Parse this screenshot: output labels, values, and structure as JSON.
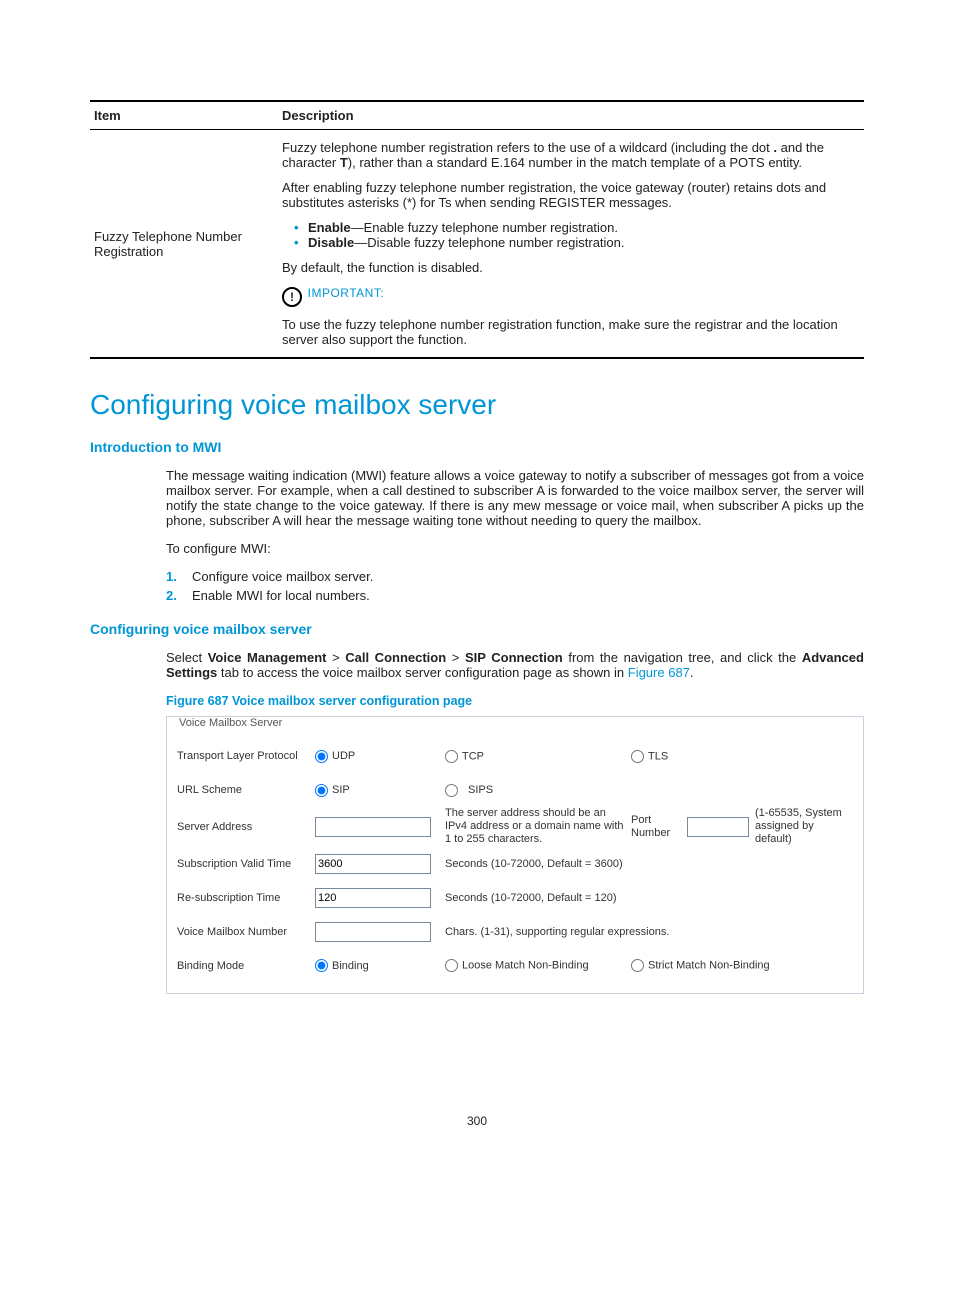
{
  "table": {
    "header_item": "Item",
    "header_desc": "Description",
    "row_label": "Fuzzy Telephone Number Registration",
    "p1_a": "Fuzzy telephone number registration refers to the use of a wildcard (including the dot ",
    "p1_dot": ".",
    "p1_b": " and the character ",
    "p1_T": "T",
    "p1_c": "), rather than a standard E.164 number in the match template of a POTS entity.",
    "p2": "After enabling fuzzy telephone number registration, the voice gateway (router) retains dots and substitutes asterisks (*) for Ts when sending REGISTER messages.",
    "li1_k": "Enable",
    "li1_t": "—Enable fuzzy telephone number registration.",
    "li2_k": "Disable",
    "li2_t": "—Disable fuzzy telephone number registration.",
    "p3": "By default, the function is disabled.",
    "important": "IMPORTANT:",
    "p4": "To use the fuzzy telephone number registration function, make sure the registrar and the location server also support the function."
  },
  "h1": "Configuring voice mailbox server",
  "intro_h": "Introduction to MWI",
  "intro_p": "The message waiting indication (MWI) feature allows a voice gateway to notify a subscriber of messages got from a voice mailbox server. For example, when a call destined to subscriber A is forwarded to the voice mailbox server, the server will notify the state change to the voice gateway. If there is any mew message or voice mail, when subscriber A picks up the phone, subscriber A will hear the message waiting tone without needing to query the mailbox.",
  "intro_p2": "To configure MWI:",
  "steps": [
    "Configure voice mailbox server.",
    "Enable MWI for local numbers."
  ],
  "cfg_h": "Configuring voice mailbox server",
  "cfg_p_a": "Select ",
  "cfg_vm": "Voice Management",
  "cfg_gt": " > ",
  "cfg_cc": "Call Connection",
  "cfg_sc": "SIP Connection",
  "cfg_p_b": " from the navigation tree, and click the ",
  "cfg_as": "Advanced Settings",
  "cfg_p_c": " tab to access the voice mailbox server configuration page as shown in ",
  "cfg_ref": "Figure 687",
  "cfg_dot": ".",
  "fig_cap": "Figure 687 Voice mailbox server configuration page",
  "panel": {
    "legend": "Voice Mailbox Server",
    "tlp": "Transport Layer Protocol",
    "udp": "UDP",
    "tcp": "TCP",
    "tls": "TLS",
    "url": "URL Scheme",
    "sip": "SIP",
    "sips": "SIPS",
    "sa": "Server Address",
    "sa_hint": "The server address should be an IPv4 address or a domain name with 1 to 255 characters.",
    "port_l": "Port Number",
    "port_hint": "(1-65535, System assigned by default)",
    "svt": "Subscription Valid Time",
    "svt_v": "3600",
    "svt_hint": "Seconds (10-72000, Default = 3600)",
    "rst": "Re-subscription Time",
    "rst_v": "120",
    "rst_hint": "Seconds (10-72000, Default = 120)",
    "vmn": "Voice Mailbox Number",
    "vmn_hint": "Chars. (1-31), supporting regular expressions.",
    "bm": "Binding Mode",
    "bm1": "Binding",
    "bm2": "Loose Match Non-Binding",
    "bm3": "Strict Match Non-Binding"
  },
  "pagenum": "300"
}
